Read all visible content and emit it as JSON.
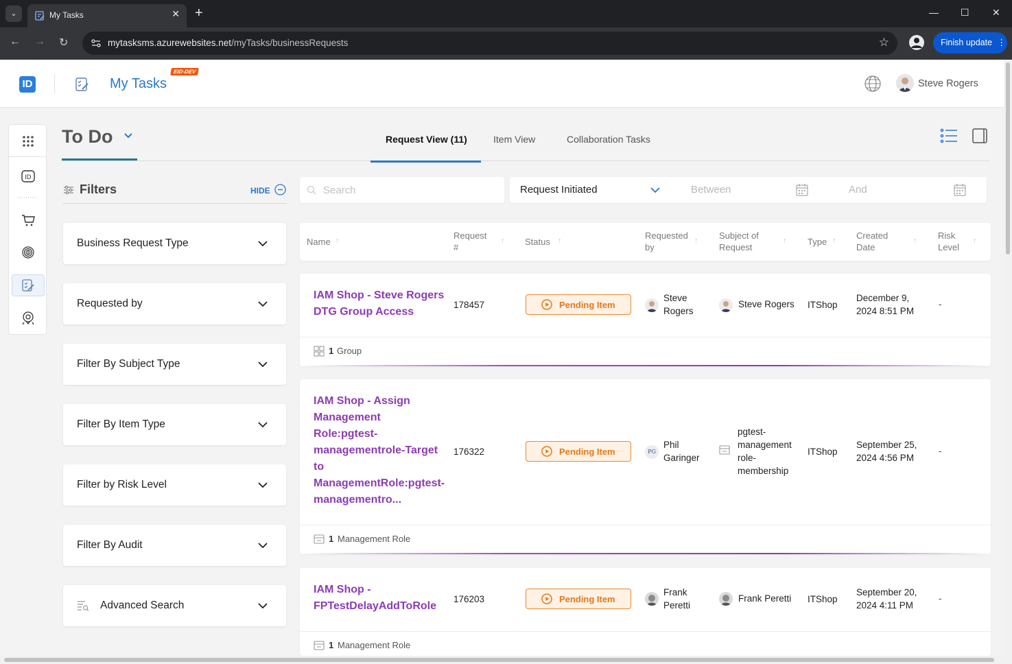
{
  "browser": {
    "tab_title": "My Tasks",
    "tab_close": "✕",
    "new_tab": "+",
    "url_host": "mytasksms.azurewebsites.net",
    "url_path": "/myTasks/businessRequests",
    "finish_update": "Finish update",
    "win_minimize": "—",
    "win_maximize": "☐",
    "win_close": "✕"
  },
  "header": {
    "logo": "ID",
    "app_title": "My Tasks",
    "env_badge": "EID-DEV",
    "user_name": "Steve Rogers"
  },
  "page": {
    "title": "To Do",
    "tabs": [
      {
        "label": "Request View (11)"
      },
      {
        "label": "Item View"
      },
      {
        "label": "Collaboration Tasks"
      }
    ]
  },
  "filters": {
    "title": "Filters",
    "hide": "HIDE",
    "items": [
      {
        "label": "Business Request Type"
      },
      {
        "label": "Requested by"
      },
      {
        "label": "Filter By Subject Type"
      },
      {
        "label": "Filter By Item Type"
      },
      {
        "label": "Filter by Risk Level"
      },
      {
        "label": "Filter By Audit"
      },
      {
        "label": "Advanced Search"
      }
    ]
  },
  "search": {
    "placeholder": "Search",
    "value": "",
    "date_field": "Request Initiated",
    "between": "Between",
    "and": "And"
  },
  "table": {
    "columns": [
      {
        "l1": "Name",
        "l2": ""
      },
      {
        "l1": "Request",
        "l2": "#"
      },
      {
        "l1": "Status",
        "l2": ""
      },
      {
        "l1": "Requested",
        "l2": "by"
      },
      {
        "l1": "Subject of",
        "l2": "Request"
      },
      {
        "l1": "Type",
        "l2": ""
      },
      {
        "l1": "Created",
        "l2": "Date"
      },
      {
        "l1": "Risk",
        "l2": "Level"
      }
    ],
    "rows": [
      {
        "name_lines": [
          "IAM Shop - Steve Rogers",
          "DTG Group Access"
        ],
        "request_num": "178457",
        "status": "Pending Item",
        "requested_by": [
          "Steve",
          "Rogers"
        ],
        "subject": [
          "Steve Rogers"
        ],
        "type": "ITShop",
        "created": [
          "December 9,",
          "2024 8:51 PM"
        ],
        "risk": "-",
        "item_count": "1",
        "item_type": "Group"
      },
      {
        "name_lines": [
          "IAM Shop - Assign",
          "Management",
          "Role:pgtest-",
          "managementrole-Target",
          "to",
          "ManagementRole:pgtest-",
          "managementro..."
        ],
        "request_num": "176322",
        "status": "Pending Item",
        "requested_by": [
          "Phil",
          "Garinger"
        ],
        "requested_by_initials": "PG",
        "subject": [
          "pgtest-",
          "management",
          "role-",
          "membership"
        ],
        "type": "ITShop",
        "created": [
          "September 25,",
          "2024 4:56 PM"
        ],
        "risk": "-",
        "item_count": "1",
        "item_type": "Management Role"
      },
      {
        "name_lines": [
          "IAM Shop -",
          "FPTestDelayAddToRole"
        ],
        "request_num": "176203",
        "status": "Pending Item",
        "requested_by": [
          "Frank",
          "Peretti"
        ],
        "subject": [
          "Frank Peretti"
        ],
        "type": "ITShop",
        "created": [
          "September 20,",
          "2024 4:11 PM"
        ],
        "risk": "-",
        "item_count": "1",
        "item_type": "Management Role"
      }
    ]
  },
  "colors": {
    "primary": "#2a79c9",
    "link_purple": "#8d3bb5",
    "pending_orange": "#e37a1d",
    "todo_underline": "#26798c"
  }
}
